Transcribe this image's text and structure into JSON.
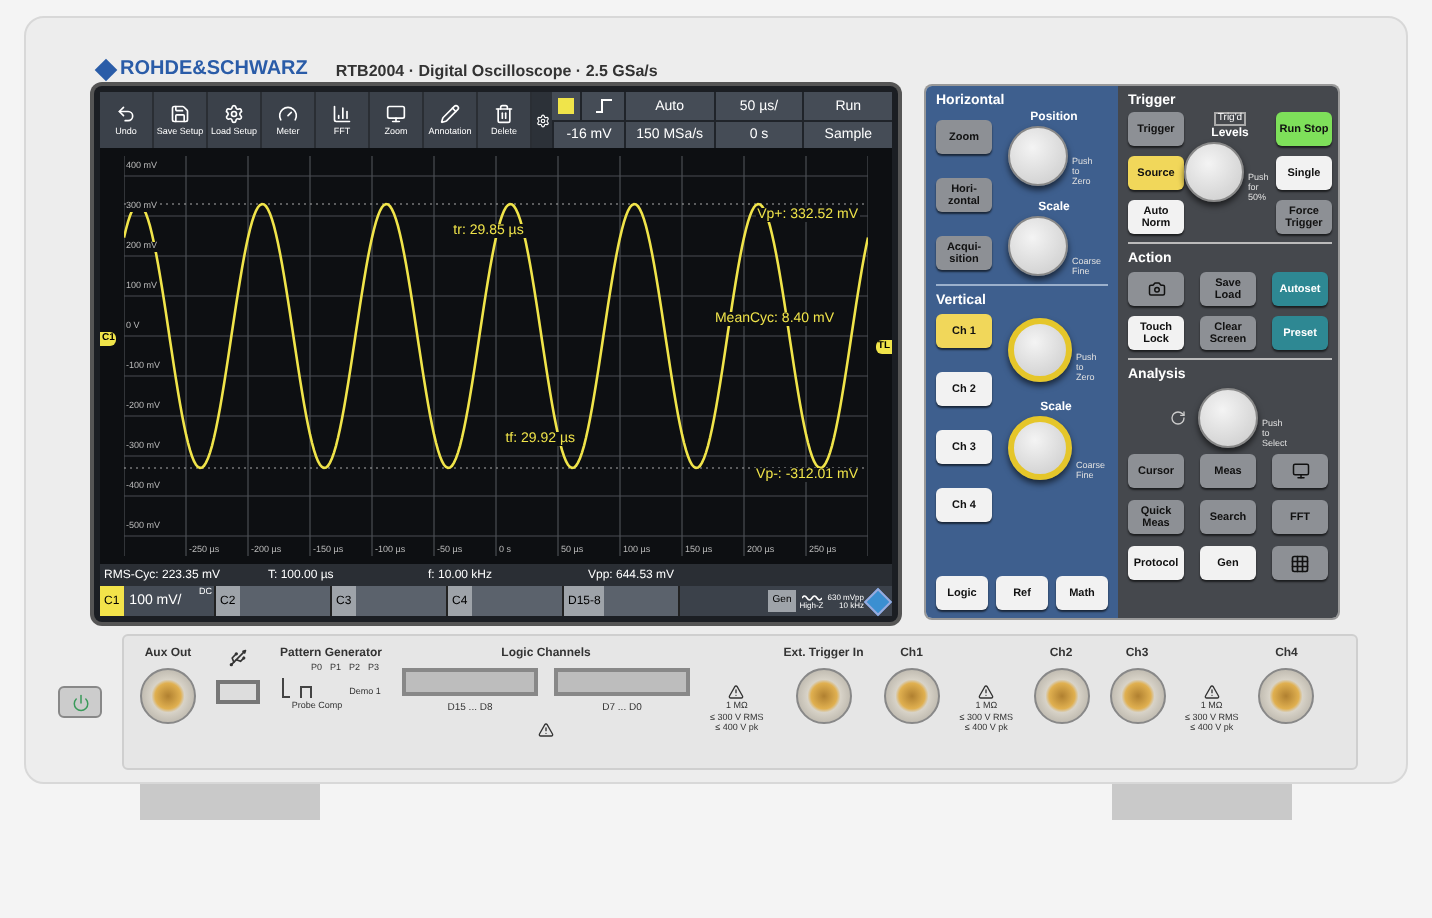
{
  "brand": {
    "logo": "ROHDE&SCHWARZ",
    "model": "RTB2004 · Digital Oscilloscope · 2.5 GSa/s"
  },
  "screen": {
    "tools": [
      {
        "label": "Undo"
      },
      {
        "label": "Save Setup"
      },
      {
        "label": "Load Setup"
      },
      {
        "label": "Meter"
      },
      {
        "label": "FFT"
      },
      {
        "label": "Zoom"
      },
      {
        "label": "Annotation"
      },
      {
        "label": "Delete"
      }
    ],
    "status": {
      "mode": "Auto",
      "time_scale": "50 µs/",
      "run_state": "Run",
      "trigger_level": "-16 mV",
      "sample_rate": "150 MSa/s",
      "offset": "0 s",
      "acquisition": "Sample"
    },
    "y_labels": [
      "400 mV",
      "300 mV",
      "200 mV",
      "100 mV",
      "0 V",
      "-100 mV",
      "-200 mV",
      "-300 mV",
      "-400 mV",
      "-500 mV"
    ],
    "x_labels": [
      "-250 µs",
      "-200 µs",
      "-150 µs",
      "-100 µs",
      "-50 µs",
      "0 s",
      "50 µs",
      "100 µs",
      "150 µs",
      "200 µs",
      "250 µs"
    ],
    "annotations": [
      {
        "text": "Vp+: 332.52 mV"
      },
      {
        "text": "tr: 29.85 µs"
      },
      {
        "text": "MeanCyc: 8.40 mV"
      },
      {
        "text": "tf: 29.92 µs"
      },
      {
        "text": "Vp-: -312.01 mV"
      }
    ],
    "ground_marker": "C1",
    "trigger_marker": "TL",
    "measurements": [
      "RMS-Cyc: 223.35 mV",
      "T: 100.00 µs",
      "f: 10.00 kHz",
      "Vpp: 644.53 mV"
    ],
    "channels": [
      {
        "label": "C1",
        "value": "100 mV/",
        "coupling": "DC",
        "selected": true
      },
      {
        "label": "C2",
        "selected": false
      },
      {
        "label": "C3",
        "selected": false
      },
      {
        "label": "C4",
        "selected": false
      },
      {
        "label": "D15-8",
        "selected": false
      }
    ],
    "generator": {
      "label": "Gen",
      "impedance": "High-Z",
      "amplitude": "630 mVpp",
      "frequency": "10 kHz"
    }
  },
  "panel": {
    "horizontal": {
      "title": "Horizontal",
      "buttons": [
        {
          "label": "Zoom",
          "kind": "gray"
        },
        {
          "label": "Hori-zontal",
          "kind": "gray"
        },
        {
          "label": "Acqui-sition",
          "kind": "gray"
        }
      ],
      "knobs": [
        {
          "label": "Position",
          "hint": "Push to Zero",
          "lit": false
        },
        {
          "label": "Scale",
          "hint": "Coarse Fine",
          "lit": false
        }
      ]
    },
    "vertical": {
      "title": "Vertical",
      "buttons": [
        {
          "label": "Ch 1",
          "kind": "yellow"
        },
        {
          "label": "Ch 2",
          "kind": "white"
        },
        {
          "label": "Ch 3",
          "kind": "white"
        },
        {
          "label": "Ch 4",
          "kind": "white"
        }
      ],
      "knobs": [
        {
          "hint": "Push to Zero",
          "lit": true
        },
        {
          "label": "Scale",
          "hint": "Coarse Fine",
          "lit": true
        }
      ],
      "bottom_buttons": [
        {
          "label": "Logic",
          "kind": "white"
        },
        {
          "label": "Ref",
          "kind": "white"
        },
        {
          "label": "Math",
          "kind": "white"
        }
      ]
    },
    "trigger": {
      "title": "Trigger",
      "indicator": "Trig'd",
      "knob": {
        "label": "Levels",
        "hint": "Push for 50%",
        "lit": false
      },
      "buttons": [
        {
          "label": "Trigger",
          "kind": "gray"
        },
        {
          "label": "Source",
          "kind": "yellow"
        },
        {
          "label": "Auto Norm",
          "kind": "white"
        },
        {
          "label": "Run Stop",
          "kind": "green"
        },
        {
          "label": "Single",
          "kind": "white"
        },
        {
          "label": "Force Trigger",
          "kind": "gray"
        }
      ]
    },
    "action": {
      "title": "Action",
      "buttons": [
        {
          "kind": "camera"
        },
        {
          "label": "Save Load",
          "kind": "gray"
        },
        {
          "label": "Autoset",
          "kind": "teal"
        },
        {
          "label": "Touch Lock",
          "kind": "white"
        },
        {
          "label": "Clear Screen",
          "kind": "gray"
        },
        {
          "label": "Preset",
          "kind": "teal"
        }
      ]
    },
    "analysis": {
      "title": "Analysis",
      "knob": {
        "hint": "Push to Select",
        "lit": false
      },
      "buttons": [
        {
          "label": "Cursor",
          "kind": "gray"
        },
        {
          "label": "Meas",
          "kind": "gray"
        },
        {
          "kind": "display"
        },
        {
          "label": "Quick Meas",
          "kind": "gray"
        },
        {
          "label": "Search",
          "kind": "gray"
        },
        {
          "label": "FFT",
          "kind": "gray"
        },
        {
          "label": "Protocol",
          "kind": "white"
        },
        {
          "label": "Gen",
          "kind": "white"
        },
        {
          "kind": "grid"
        }
      ]
    }
  },
  "front": {
    "aux_out": "Aux Out",
    "pattern_generator": {
      "title": "Pattern Generator",
      "pins": [
        "P0",
        "P1",
        "P2",
        "P3"
      ],
      "probe_comp": "Probe Comp",
      "demo": "Demo 1"
    },
    "logic": {
      "title": "Logic Channels",
      "ports": [
        "D15 ... D8",
        "D7 ... D0"
      ]
    },
    "connectors": [
      {
        "kind": "warning",
        "lines": [
          "1 MΩ",
          "≤ 300 V RMS",
          "≤ 400 V pk"
        ]
      },
      {
        "kind": "bnc",
        "label": "Ext. Trigger In"
      },
      {
        "kind": "bnc",
        "label": "Ch1"
      },
      {
        "kind": "warning",
        "lines": [
          "1 MΩ",
          "≤ 300 V RMS",
          "≤ 400 V pk"
        ]
      },
      {
        "kind": "bnc",
        "label": "Ch2"
      },
      {
        "kind": "bnc",
        "label": "Ch3"
      },
      {
        "kind": "warning",
        "lines": [
          "1 MΩ",
          "≤ 300 V RMS",
          "≤ 400 V pk"
        ]
      },
      {
        "kind": "bnc",
        "label": "Ch4"
      }
    ]
  }
}
